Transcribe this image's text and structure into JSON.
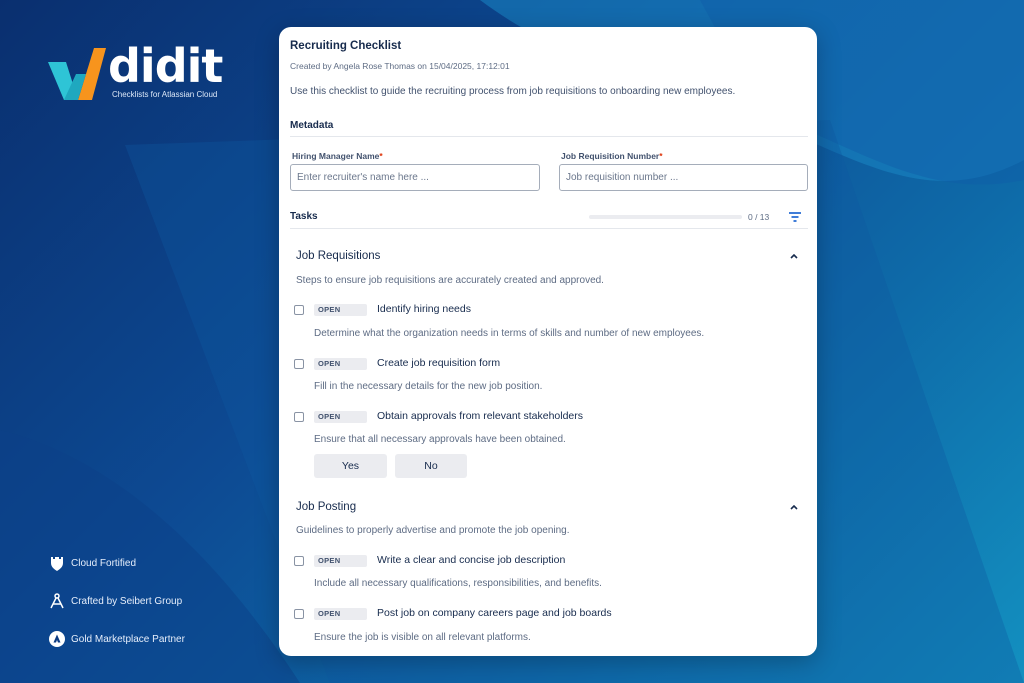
{
  "brand": {
    "name": "didit",
    "tagline": "Checklists for Atlassian Cloud",
    "accent_cyan": "#2ec4d6",
    "accent_orange": "#f7941d"
  },
  "badges": [
    {
      "icon": "fortress-icon",
      "label": "Cloud Fortified"
    },
    {
      "icon": "compass-icon",
      "label": "Crafted by Seibert Group"
    },
    {
      "icon": "atlassian-icon",
      "label": "Gold Marketplace Partner"
    }
  ],
  "card": {
    "title": "Recruiting Checklist",
    "meta": "Created by Angela Rose Thomas on 15/04/2025, 17:12:01",
    "description": "Use this checklist to guide the recruiting process from job requisitions to onboarding new employees.",
    "metadata_heading": "Metadata",
    "fields": [
      {
        "label": "Hiring Manager Name",
        "required_mark": "*",
        "placeholder": "Enter recruiter's name here ...",
        "value": ""
      },
      {
        "label": "Job Requisition Number",
        "required_mark": "*",
        "placeholder": "Job requisition number ...",
        "value": ""
      }
    ],
    "tasks_heading": "Tasks",
    "progress": {
      "completed": 0,
      "total": 13,
      "label": "0 / 13"
    },
    "groups": [
      {
        "title": "Job Requisitions",
        "description": "Steps to ensure job requisitions are accurately created and approved.",
        "tasks": [
          {
            "status": "OPEN",
            "title": "Identify hiring needs",
            "description": "Determine what the organization needs in terms of skills and number of new employees."
          },
          {
            "status": "OPEN",
            "title": "Create job requisition form",
            "description": "Fill in the necessary details for the new job position."
          },
          {
            "status": "OPEN",
            "title": "Obtain approvals from relevant stakeholders",
            "description": "Ensure that all necessary approvals have been obtained.",
            "options": [
              "Yes",
              "No"
            ]
          }
        ]
      },
      {
        "title": "Job Posting",
        "description": "Guidelines to properly advertise and promote the job opening.",
        "tasks": [
          {
            "status": "OPEN",
            "title": "Write a clear and concise job description",
            "description": "Include all necessary qualifications, responsibilities, and benefits."
          },
          {
            "status": "OPEN",
            "title": "Post job on company careers page and job boards",
            "description": "Ensure the job is visible on all relevant platforms."
          }
        ]
      }
    ]
  }
}
